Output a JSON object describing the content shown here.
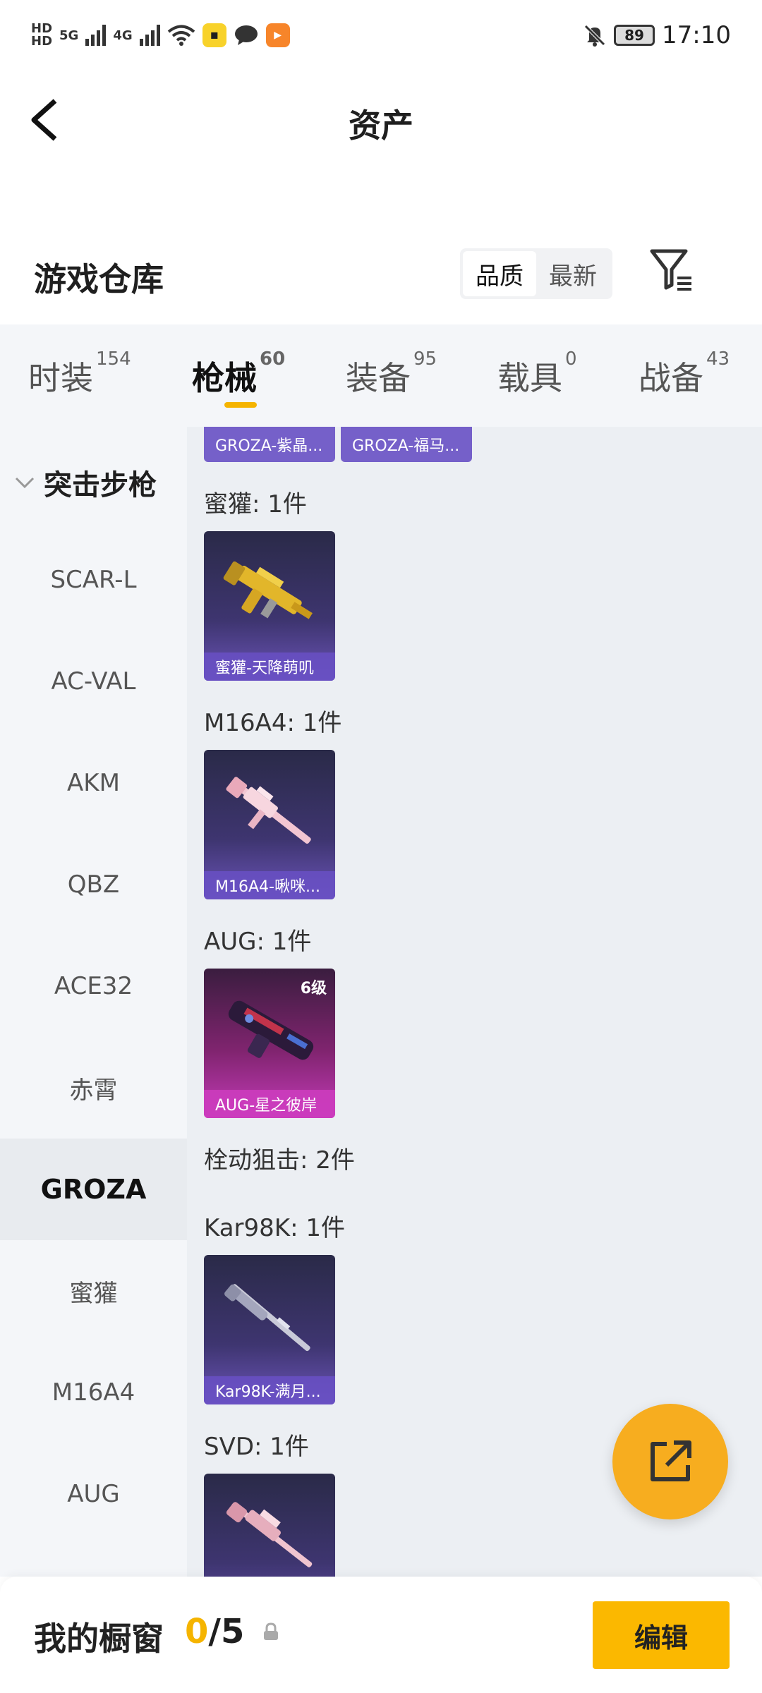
{
  "status_bar": {
    "hd1": "HD",
    "hd2": "HD",
    "net1": "5G",
    "net2": "4G",
    "battery": "89",
    "time": "17:10"
  },
  "nav": {
    "title": "资产"
  },
  "section": {
    "title": "游戏仓库",
    "sort_options": [
      "品质",
      "最新"
    ]
  },
  "tabs": [
    {
      "label": "时装",
      "count": "154"
    },
    {
      "label": "枪械",
      "count": "60"
    },
    {
      "label": "装备",
      "count": "95"
    },
    {
      "label": "载具",
      "count": "0"
    },
    {
      "label": "战备",
      "count": "43"
    }
  ],
  "sidebar": {
    "header": "突击步枪",
    "items": [
      "SCAR-L",
      "AC-VAL",
      "AKM",
      "QBZ",
      "ACE32",
      "赤霄",
      "GROZA",
      "蜜獾",
      "M16A4",
      "AUG"
    ]
  },
  "content": {
    "partial_cards": [
      "GROZA-紫晶...",
      "GROZA-福马..."
    ],
    "groups": [
      {
        "label": "蜜獾: 1件",
        "card": "蜜獾-天降萌叽"
      },
      {
        "label": "M16A4: 1件",
        "card": "M16A4-啾咪..."
      },
      {
        "label": "AUG: 1件",
        "card": "AUG-星之彼岸",
        "level": "6级"
      },
      {
        "label": "栓动狙击: 2件"
      },
      {
        "label": "Kar98K: 1件",
        "card": "Kar98K-满月..."
      },
      {
        "label": "SVD: 1件"
      }
    ]
  },
  "bottom": {
    "title": "我的橱窗",
    "used": "0",
    "total": "/5",
    "edit_label": "编辑"
  }
}
